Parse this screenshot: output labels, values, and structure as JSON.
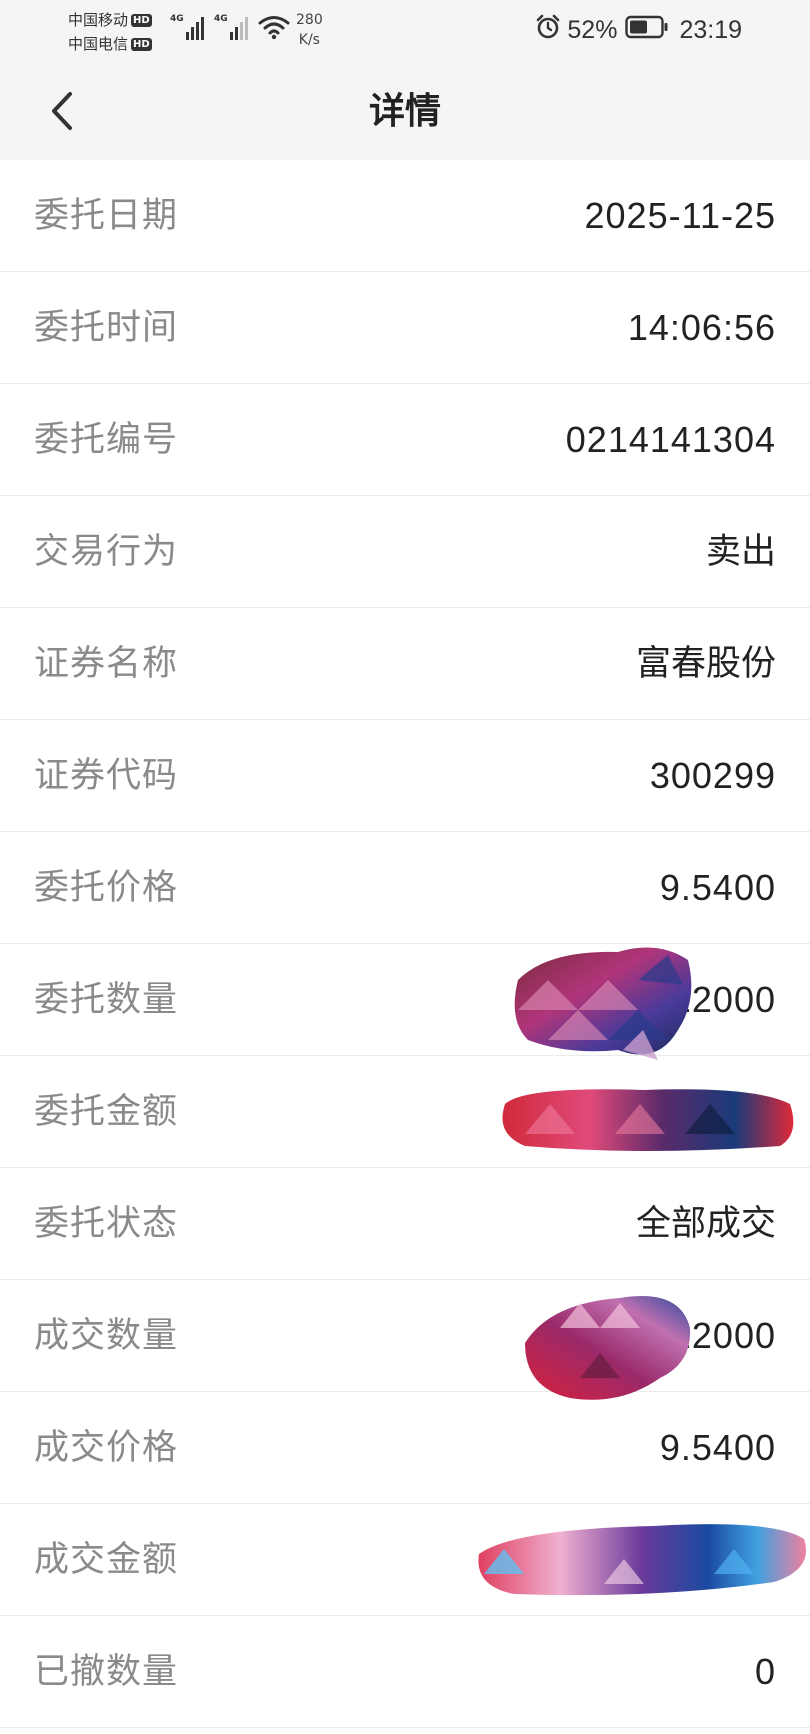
{
  "status_bar": {
    "carrier_1": "中国移动",
    "carrier_2": "中国电信",
    "hd_badge": "HD",
    "network_tag": "4G",
    "net_speed_value": "280",
    "net_speed_unit": "K/s",
    "battery_percent": "52%",
    "clock": "23:19",
    "icons": [
      "signal-bars-icon",
      "wifi-icon",
      "alarm-clock-icon",
      "battery-icon"
    ]
  },
  "header": {
    "title": "详情",
    "back_icon": "chevron-left-icon"
  },
  "details": {
    "rows": [
      {
        "label": "委托日期",
        "value": "2025-11-25"
      },
      {
        "label": "委托时间",
        "value": "14:06:56"
      },
      {
        "label": "委托编号",
        "value": "0214141304"
      },
      {
        "label": "交易行为",
        "value": "卖出"
      },
      {
        "label": "证券名称",
        "value": "富春股份"
      },
      {
        "label": "证券代码",
        "value": "300299"
      },
      {
        "label": "委托价格",
        "value": "9.5400"
      },
      {
        "label": "委托数量",
        "value": "22000"
      },
      {
        "label": "委托金额",
        "value": ""
      },
      {
        "label": "委托状态",
        "value": "全部成交"
      },
      {
        "label": "成交数量",
        "value": "22000"
      },
      {
        "label": "成交价格",
        "value": "9.5400"
      },
      {
        "label": "成交金额",
        "value": ""
      },
      {
        "label": "已撤数量",
        "value": "0"
      }
    ]
  },
  "colors": {
    "header_bg": "#f5f5f5",
    "label_text": "#8a8a8a",
    "value_text": "#222222",
    "divider": "#ebebeb"
  }
}
